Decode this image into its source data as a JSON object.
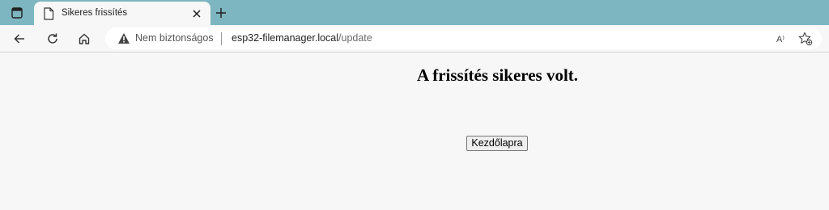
{
  "browser": {
    "tab": {
      "title": "Sikeres frissítés"
    },
    "address_bar": {
      "security_label": "Nem biztonságos",
      "url_host": "esp32-filemanager.local",
      "url_path": "/update",
      "read_aloud_icon_text": "A⁾"
    },
    "icons": {
      "tab_actions": "tab-actions-icon",
      "favicon": "page-icon",
      "close": "close-icon",
      "new_tab": "plus-icon",
      "back": "back-arrow-icon",
      "refresh": "refresh-icon",
      "home": "home-icon",
      "warning": "warning-icon",
      "read_aloud": "read-aloud-icon",
      "add_favorite": "add-favorite-icon"
    },
    "colors": {
      "tabstrip": "#7db6c0",
      "page_bg": "#f7f7f7"
    }
  },
  "page": {
    "heading": "A frissítés sikeres volt.",
    "home_button_label": "Kezdőlapra"
  }
}
